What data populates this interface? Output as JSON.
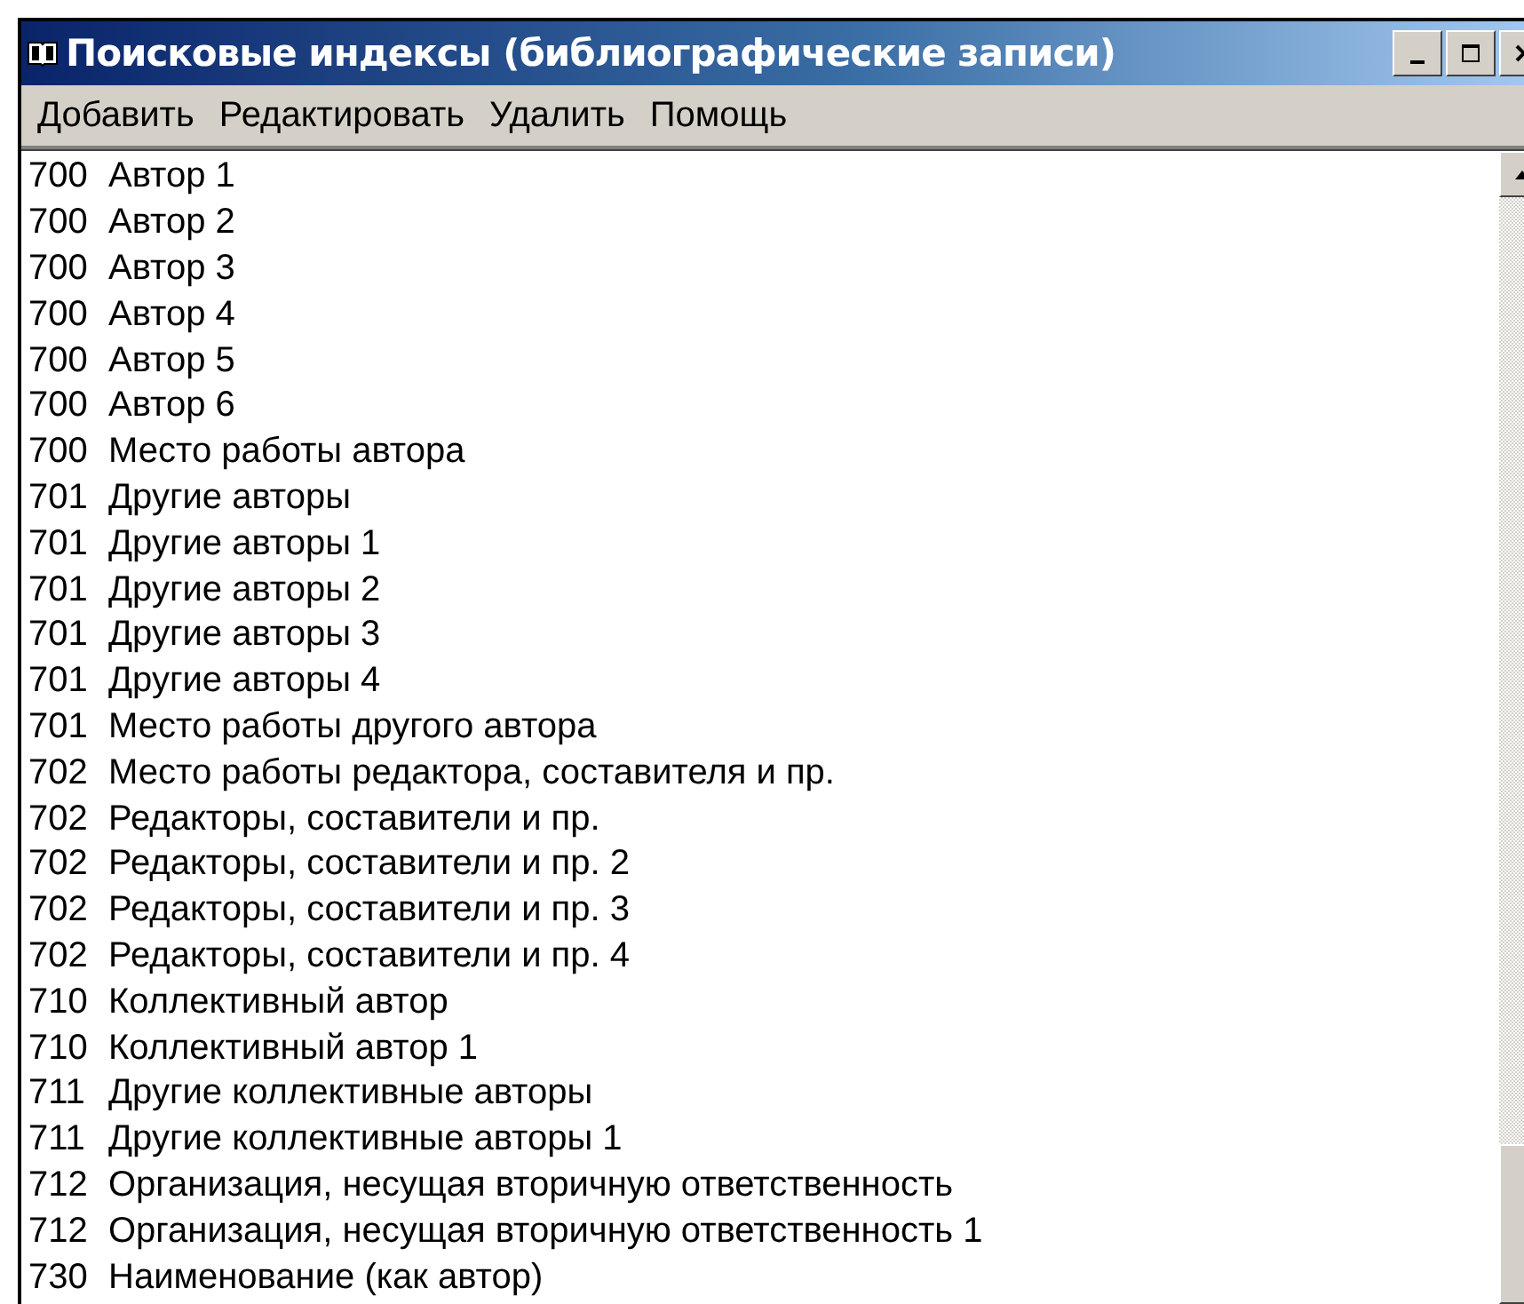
{
  "window": {
    "title": "Поисковые индексы (библиографические записи)"
  },
  "menu": [
    "Добавить",
    "Редактировать",
    "Удалить",
    "Помощь"
  ],
  "items": [
    {
      "code": "700",
      "label": "Автор 1"
    },
    {
      "code": "700",
      "label": "Автор 2"
    },
    {
      "code": "700",
      "label": "Автор 3"
    },
    {
      "code": "700",
      "label": "Автор 4"
    },
    {
      "code": "700",
      "label": "Автор 5"
    },
    {
      "code": "700",
      "label": "Автор 6"
    },
    {
      "code": "700",
      "label": "Место работы автора"
    },
    {
      "code": "701",
      "label": "Другие авторы"
    },
    {
      "code": "701",
      "label": "Другие авторы 1"
    },
    {
      "code": "701",
      "label": "Другие авторы 2"
    },
    {
      "code": "701",
      "label": "Другие авторы 3"
    },
    {
      "code": "701",
      "label": "Другие авторы 4"
    },
    {
      "code": "701",
      "label": "Место работы другого автора"
    },
    {
      "code": "702",
      "label": "Место работы редактора, составителя и пр."
    },
    {
      "code": "702",
      "label": "Редакторы, составители и пр."
    },
    {
      "code": "702",
      "label": "Редакторы, составители и пр. 2"
    },
    {
      "code": "702",
      "label": "Редакторы, составители и пр. 3"
    },
    {
      "code": "702",
      "label": "Редакторы, составители и пр. 4"
    },
    {
      "code": "710",
      "label": "Коллективный автор"
    },
    {
      "code": "710",
      "label": "Коллективный автор 1"
    },
    {
      "code": "711",
      "label": "Другие коллективные авторы"
    },
    {
      "code": "711",
      "label": "Другие коллективные авторы 1"
    },
    {
      "code": "712",
      "label": "Организация, несущая вторичную ответственность"
    },
    {
      "code": "712",
      "label": "Организация, несущая вторичную ответственность 1"
    },
    {
      "code": "730",
      "label": "Наименование (как автор)"
    }
  ]
}
